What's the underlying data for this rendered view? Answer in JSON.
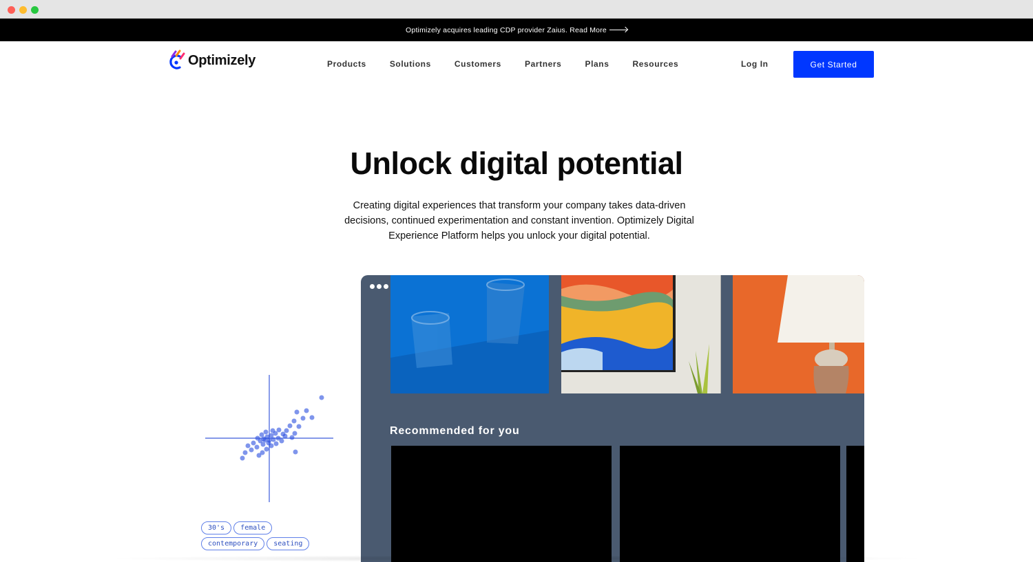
{
  "announcement": {
    "text": "Optimizely acquires leading CDP provider Zaius. Read More"
  },
  "logo": {
    "text": "Optimizely"
  },
  "nav": {
    "items": [
      {
        "label": "Products"
      },
      {
        "label": "Solutions"
      },
      {
        "label": "Customers"
      },
      {
        "label": "Partners"
      },
      {
        "label": "Plans"
      },
      {
        "label": "Resources"
      }
    ],
    "login_label": "Log In",
    "cta_label": "Get Started"
  },
  "hero": {
    "title": "Unlock digital potential",
    "subtitle": "Creating digital experiences that transform your company takes data-driven decisions, continued experimentation and constant invention. Optimizely Digital Experience Platform helps you unlock your digital potential."
  },
  "illustration": {
    "tags": [
      "30's",
      "female",
      "contemporary",
      "seating"
    ]
  },
  "mockup": {
    "recommended_label": "Recommended for you"
  },
  "colors": {
    "accent": "#0037ff",
    "mock_bg": "#4a5a70",
    "scatter": "#2a4fe0"
  }
}
